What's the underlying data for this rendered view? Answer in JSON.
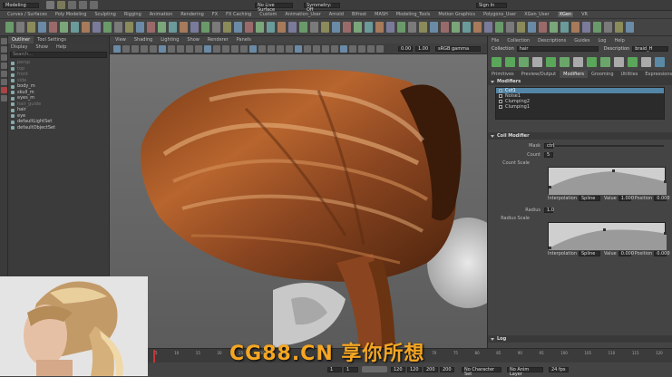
{
  "topbar": {
    "workspace": "Modeling",
    "surface": "No Live Surface",
    "symmetry": "Symmetry: Off",
    "signin": "Sign In"
  },
  "menubar": {
    "items": [
      "Curves / Surfaces",
      "Poly Modeling",
      "Sculpting",
      "Rigging",
      "Animation",
      "Rendering",
      "FX",
      "FX Caching",
      "Custom",
      "Animation_User",
      "Arnold",
      "Bifrost",
      "MASH",
      "Modeling_Tools",
      "Motion Graphics",
      "Polygons_User",
      "XGen_User",
      "XGen",
      "VR"
    ],
    "active": "XGen"
  },
  "outliner": {
    "tabs": [
      "Outliner",
      "Tool Settings"
    ],
    "menu": [
      "Display",
      "Show",
      "Help"
    ],
    "search": "Search...",
    "items": [
      {
        "label": "persp",
        "dim": true
      },
      {
        "label": "top",
        "dim": true
      },
      {
        "label": "front",
        "dim": true
      },
      {
        "label": "side",
        "dim": true
      },
      {
        "label": "body_m",
        "dim": false
      },
      {
        "label": "skull_m",
        "dim": false
      },
      {
        "label": "eyes_m",
        "dim": false
      },
      {
        "label": "hair_guide",
        "dim": true
      },
      {
        "label": "hair",
        "dim": false
      },
      {
        "label": "eye",
        "dim": false
      },
      {
        "label": "defaultLightSet",
        "dim": false
      },
      {
        "label": "defaultObjectSet",
        "dim": false
      }
    ]
  },
  "viewport": {
    "menu": [
      "View",
      "Shading",
      "Lighting",
      "Show",
      "Renderer",
      "Panels"
    ],
    "colorspace": "sRGB gamma",
    "field1": "0.00",
    "field2": "1.00"
  },
  "xgen": {
    "menu": [
      "File",
      "Collection",
      "Descriptions",
      "Guides",
      "Log",
      "Help"
    ],
    "collection_label": "Collection",
    "collection_value": "hair",
    "description_label": "Description",
    "description_value": "braid_H",
    "tabs": [
      "Primitives",
      "Preview/Output",
      "Modifiers",
      "Grooming",
      "Utilities",
      "Expressions"
    ],
    "active_tab": "Modifiers",
    "modifiers_title": "Modifiers",
    "modifiers": [
      "Cut1",
      "Noise1",
      "Clumping2",
      "Clumping1"
    ],
    "coil_title": "Coil Modifier",
    "mask_label": "Mask",
    "mask_value": "ctrl",
    "count_label": "Count",
    "count_value": "5",
    "count_scale_label": "Count Scale",
    "interp_label": "Interpolation",
    "interp_value": "Spline",
    "value_label": "Value",
    "value_1": "1.000",
    "position_label": "Position",
    "position_1": "0.000",
    "radius_label": "Radius",
    "radius_value": "1.0",
    "radius_scale_label": "Radius Scale",
    "value_2": "0.000",
    "position_2": "0.000",
    "log_title": "Log"
  },
  "timeline": {
    "ticks": [
      "5",
      "10",
      "15",
      "20",
      "25",
      "30",
      "35",
      "40",
      "45",
      "50",
      "55",
      "60",
      "65",
      "70",
      "75",
      "80",
      "85",
      "90",
      "95",
      "100",
      "105",
      "110",
      "115",
      "120"
    ]
  },
  "range": {
    "start": "1",
    "start2": "1",
    "end": "120",
    "end2": "120",
    "v1": "200",
    "v2": "200",
    "charset": "No Character Set",
    "animlayer": "No Anim Layer",
    "fps": "24 fps"
  },
  "watermark": "CG88.CN 享你所想",
  "colors": {
    "accent": "#5285a6",
    "hair_light": "#d8955c",
    "hair_dark": "#5a2a10",
    "watermark": "#f5a623"
  }
}
